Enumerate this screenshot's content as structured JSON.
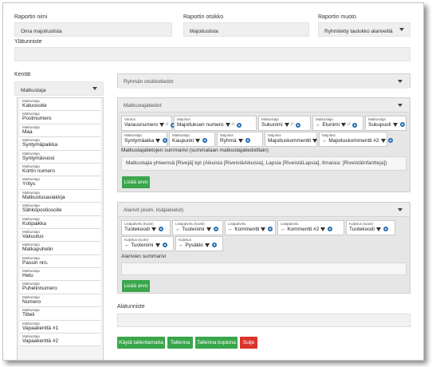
{
  "header": {
    "report_name_label": "Raportin nimi",
    "report_name_value": "Oma majoituslista",
    "report_title_label": "Raportin otsikko",
    "report_title_value": "Majoituslista",
    "report_format_label": "Raportin muoto",
    "report_format_value": "Ryhmitetty taulukko alariveillä",
    "header_row_label": "Ylätunniste"
  },
  "fields": {
    "label": "Kentät",
    "category_select": "Matkustaja",
    "items": [
      {
        "cat": "Matkustaja",
        "name": "Katuosoite"
      },
      {
        "cat": "Matkustaja",
        "name": "Postinumero"
      },
      {
        "cat": "Matkustaja",
        "name": "Maa"
      },
      {
        "cat": "Matkustaja",
        "name": "Syntymäpaikka"
      },
      {
        "cat": "Matkustaja",
        "name": "Syntymävuosi"
      },
      {
        "cat": "Matkustaja",
        "name": "Kortin numero"
      },
      {
        "cat": "Matkustaja",
        "name": "Yritys"
      },
      {
        "cat": "Matkustaja",
        "name": "Matkustusasiakirja"
      },
      {
        "cat": "Matkustaja",
        "name": "Sähköpostiosoite"
      },
      {
        "cat": "Matkustaja",
        "name": "Kotipaikka"
      },
      {
        "cat": "Matkustaja",
        "name": "Vakuutus"
      },
      {
        "cat": "Matkustaja",
        "name": "Matkapuhelin"
      },
      {
        "cat": "Matkustaja",
        "name": "Passin nro."
      },
      {
        "cat": "Matkustaja",
        "name": "Hetu"
      },
      {
        "cat": "Matkustaja",
        "name": "Puhelinnumero"
      },
      {
        "cat": "Matkustaja",
        "name": "Numero"
      },
      {
        "cat": "Matkustaja",
        "name": "Titteli"
      },
      {
        "cat": "Matkustaja",
        "name": "Vapaakenttä #1"
      },
      {
        "cat": "Matkustaja",
        "name": "Vapaakenttä #2"
      }
    ]
  },
  "group_header": {
    "title": "Ryhmän otsikkotiedot"
  },
  "traveler_panel": {
    "title": "Matkustajatiedot",
    "chips_row1": [
      {
        "cat": "Varaus",
        "name": "Varausnumero"
      },
      {
        "cat": "Majoitus",
        "name": "Majoituksen numero"
      },
      {
        "cat": "Matkustaja",
        "name": "Sukunimi"
      },
      {
        "cat": "Matkustaja",
        "name": "Etunimi"
      },
      {
        "cat": "Matkustaja",
        "name": "Sukupuoli"
      }
    ],
    "chips_row2": [
      {
        "cat": "Matkustaja",
        "name": "Syntymäaika"
      },
      {
        "cat": "Matkustaja",
        "name": "Kaupunki"
      },
      {
        "cat": "Majoitus",
        "name": "Ryhmä"
      },
      {
        "cat": "Majoitus",
        "name": "Majoituskommentti"
      },
      {
        "cat": "Majoitus",
        "name": "Majoituskommentti #2"
      }
    ],
    "summary_label": "Matkustajatietojen summarivi (summataan matkustajatiedoittain)",
    "summary_value": "Matkustajia yhteensä [Rivejä] kpl (Aikuisia [RiveistäAikuisia], Lapsia [RiveistäLapsia], Ilmaisia: [RiveistäInfantteja])",
    "add_button": "Lisää arvo"
  },
  "subrows_panel": {
    "title": "Alarivit (esim. lisäpalvelut)",
    "chips_row1": [
      {
        "cat": "Lisäpalvelu (tuote)",
        "name": "Tuotekoodi"
      },
      {
        "cat": "Lisäpalvelu (tuote)",
        "name": "Tuotenimi"
      },
      {
        "cat": "Lisäpalvelu",
        "name": "Kommentti"
      },
      {
        "cat": "Lisäpalvelu",
        "name": "Kommentti #2"
      },
      {
        "cat": "Kuljetus (tuote)",
        "name": "Tuotekoodi"
      }
    ],
    "chips_row2": [
      {
        "cat": "Kuljetus (tuote)",
        "name": "Tuotenimi"
      },
      {
        "cat": "Kuljetus",
        "name": "Pysäkki"
      }
    ],
    "summary_label": "Alarivien summarivi",
    "add_button": "Lisää arvo"
  },
  "footer": {
    "label": "Alatunniste",
    "buttons": {
      "save_unsaved": "Käytä tallentamatta",
      "save": "Tallenna",
      "save_copy": "Tallenna kopiona",
      "close": "Sulje"
    }
  },
  "colors": {
    "green": "#3aa64b",
    "red": "#d9342b",
    "gear": "#2a6fb4"
  }
}
